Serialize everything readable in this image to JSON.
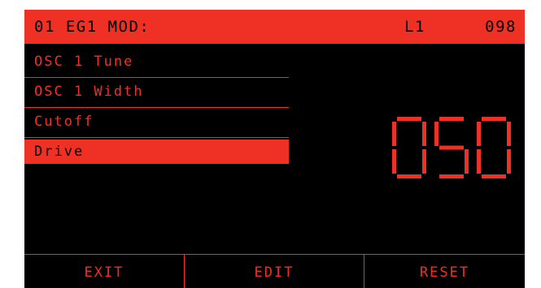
{
  "header": {
    "title": "01 EG1 MOD:",
    "layer": "L1",
    "preset_number": "098"
  },
  "destinations": [
    {
      "label": "OSC 1 Tune",
      "selected": false
    },
    {
      "label": "OSC 1 Width",
      "selected": false
    },
    {
      "label": "Cutoff",
      "selected": false
    },
    {
      "label": "Drive",
      "selected": true
    }
  ],
  "value_display": {
    "value": "050"
  },
  "softkeys": {
    "exit_label": "EXIT",
    "edit_label": "EDIT",
    "reset_label": "RESET"
  },
  "colors": {
    "accent": "#ee3124",
    "background": "#000000"
  }
}
